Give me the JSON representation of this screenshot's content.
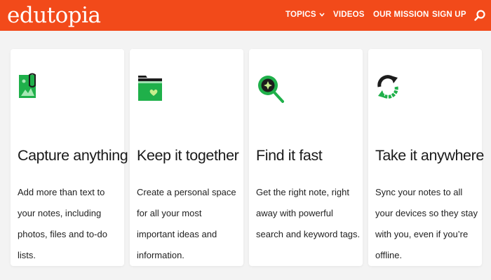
{
  "header": {
    "logo": "edutopia",
    "nav": [
      {
        "label": "TOPICS"
      },
      {
        "label": "VIDEOS"
      },
      {
        "label": "OUR MISSION"
      },
      {
        "label": "SIGN UP"
      }
    ],
    "colors": {
      "brand": "#f24a1a",
      "icon_green": "#1fb04a",
      "icon_dark": "#1c1c1c"
    }
  },
  "cards": [
    {
      "title": "Capture anything",
      "text": "Add more than text to your notes, including photos, files and to-do lists.",
      "icon": "photo-clip-icon"
    },
    {
      "title": "Keep it together",
      "text": "Create a personal space for all your most important ideas and information.",
      "icon": "folder-heart-icon"
    },
    {
      "title": "Find it fast",
      "text": "Get the right note, right away with powerful search and keyword tags.",
      "icon": "magnifier-icon"
    },
    {
      "title": "Take it anywhere",
      "text": "Sync your notes to all your devices so they stay with you, even if you’re offline.",
      "icon": "sync-icon"
    }
  ]
}
